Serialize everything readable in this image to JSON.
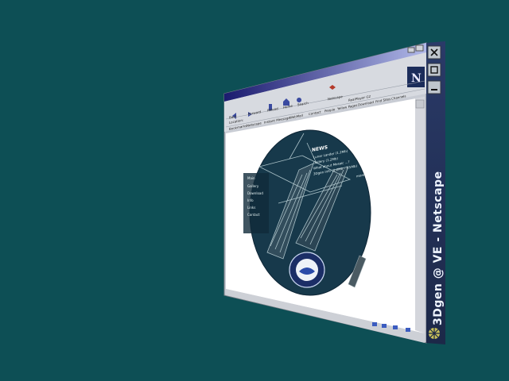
{
  "window": {
    "side_title": "3Dgen @ VE - Netscape",
    "side_buttons": [
      "close-icon",
      "maximize-icon",
      "minimize-icon"
    ]
  },
  "toolbar": {
    "buttons": [
      "Back",
      "Forward",
      "Reload",
      "Home",
      "Search",
      "Netscape"
    ],
    "location_label": "Location:",
    "bookmarks": [
      "Bookmarks",
      "Netscape",
      "Instant Message",
      "WebMail",
      "Contact",
      "People",
      "Yellow Pages",
      "Download",
      "Find Sites",
      "Channels",
      "RealPlayer G2"
    ]
  },
  "page": {
    "news_heading": "NEWS",
    "news_items": [
      "Lunar Lander (1.2Mb)",
      "Gallery (1.2Mb)",
      "What about Mosaic ...?",
      "3Dgen info (1.2Mb - 1.5Mb)"
    ],
    "more_link": "more",
    "nav": [
      "Main",
      "Gallery",
      "Download",
      "Info",
      "Links",
      "Contact"
    ]
  },
  "colors": {
    "desktop": "#0d4f55",
    "titlebar_start": "#1a1a6e",
    "titlebar_end": "#b0b8e8",
    "frame": "#c8ccd4",
    "side_bar": "#23315a",
    "page_bg": "#16384a"
  }
}
